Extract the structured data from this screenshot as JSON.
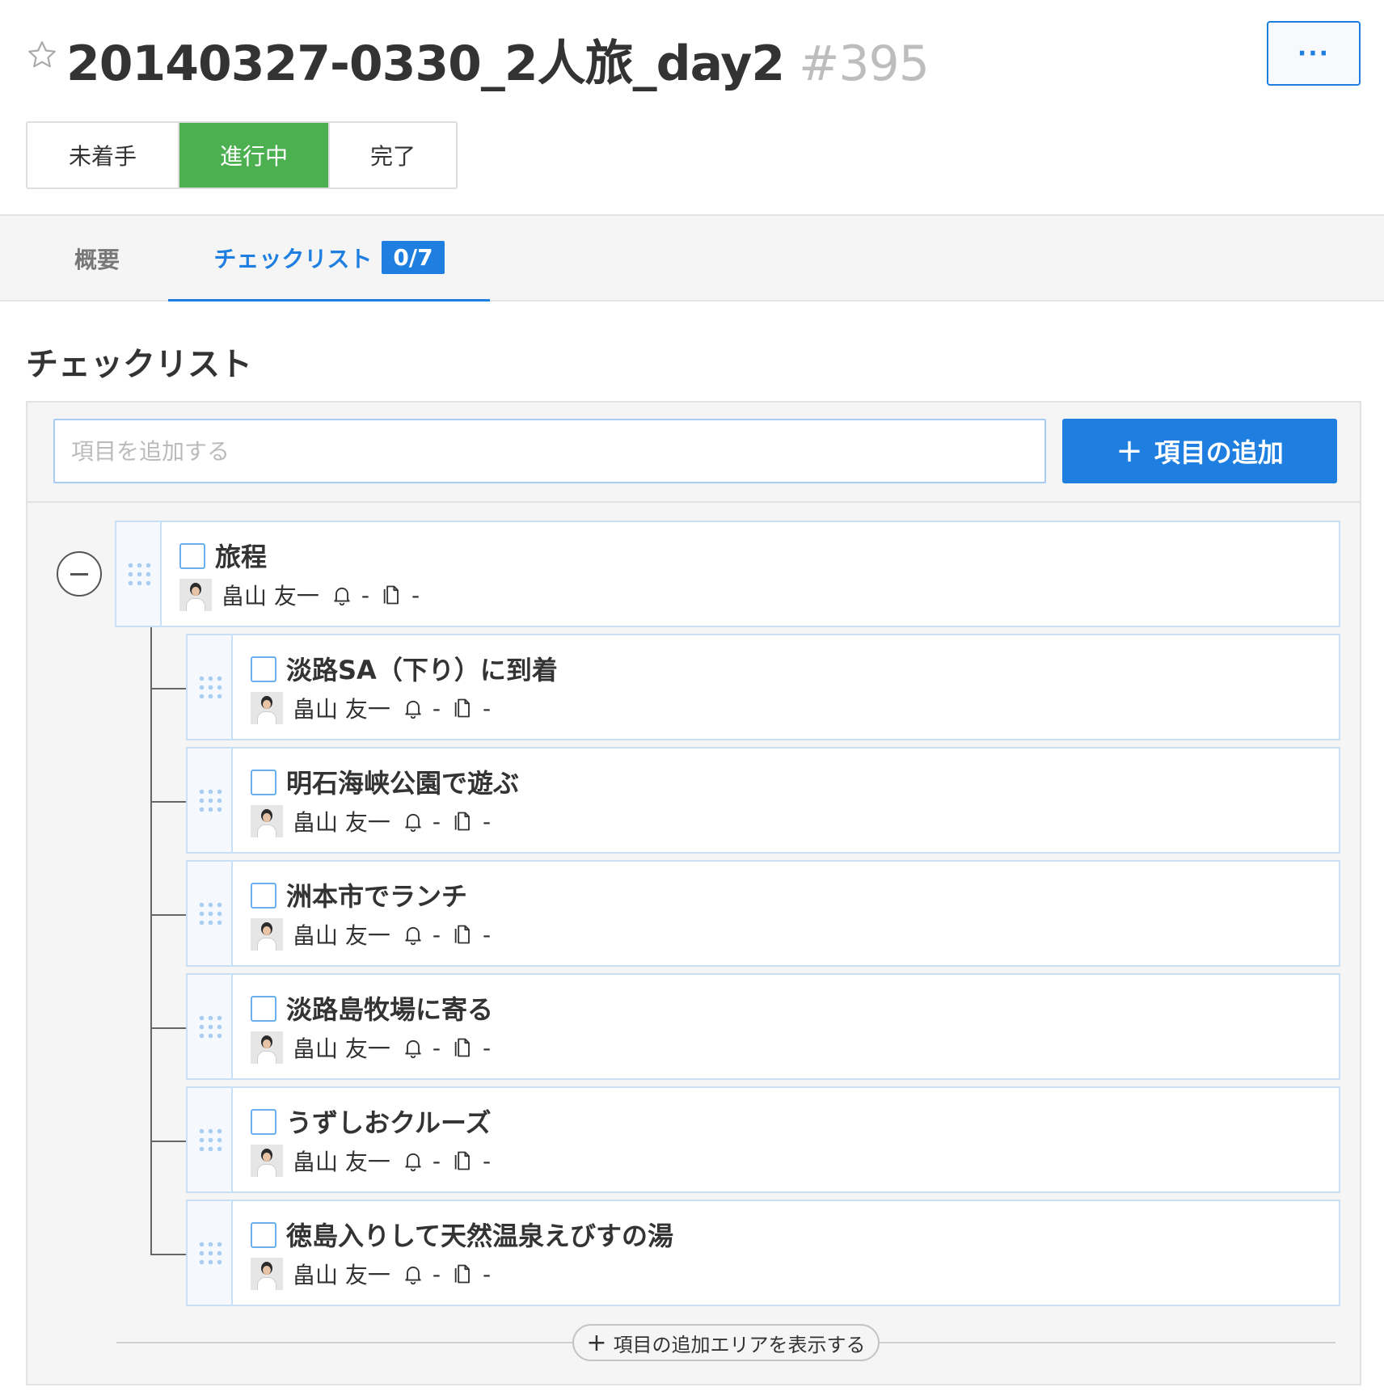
{
  "header": {
    "title": "20140327-0330_2人旅_day2",
    "number": "#395",
    "more_label": "···"
  },
  "status": {
    "options": [
      "未着手",
      "進行中",
      "完了"
    ],
    "selected": "進行中",
    "active_color": "#4caf50"
  },
  "tabs": [
    {
      "label": "概要"
    },
    {
      "label": "チェックリスト",
      "badge": "0/7"
    }
  ],
  "checklist": {
    "title": "チェックリスト",
    "input_placeholder": "項目を追加する",
    "add_button": "項目の追加",
    "show_add_area": "項目の追加エリアを表示する",
    "items": [
      {
        "label": "旅程",
        "assignee": "畠山 友一",
        "reminder": "-",
        "attachment": "-"
      },
      {
        "label": "淡路SA（下り）に到着",
        "assignee": "畠山 友一",
        "reminder": "-",
        "attachment": "-"
      },
      {
        "label": "明石海峡公園で遊ぶ",
        "assignee": "畠山 友一",
        "reminder": "-",
        "attachment": "-"
      },
      {
        "label": "洲本市でランチ",
        "assignee": "畠山 友一",
        "reminder": "-",
        "attachment": "-"
      },
      {
        "label": "淡路島牧場に寄る",
        "assignee": "畠山 友一",
        "reminder": "-",
        "attachment": "-"
      },
      {
        "label": "うずしおクルーズ",
        "assignee": "畠山 友一",
        "reminder": "-",
        "attachment": "-"
      },
      {
        "label": "徳島入りして天然温泉えびすの湯",
        "assignee": "畠山 友一",
        "reminder": "-",
        "attachment": "-"
      }
    ]
  },
  "icons": {
    "star": "star-outline-icon",
    "more": "ellipsis-icon",
    "collapse": "minus-circle-icon",
    "drag": "drag-handle-icon",
    "bell": "bell-icon",
    "attachment": "document-icon",
    "plus": "plus-icon"
  },
  "colors": {
    "accent": "#1e7fe1",
    "success": "#4caf50"
  }
}
